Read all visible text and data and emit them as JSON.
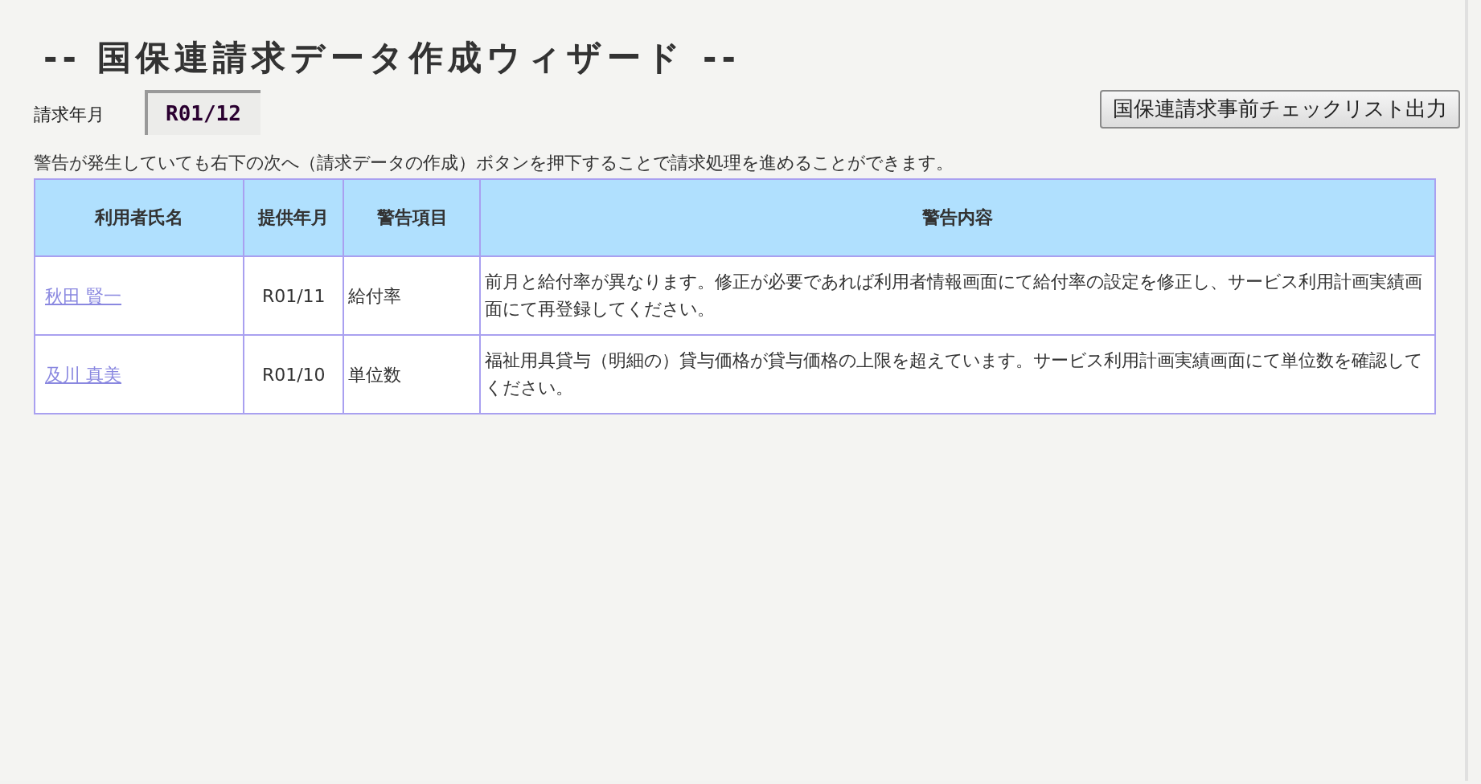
{
  "title": "-- 国保連請求データ作成ウィザード --",
  "billing_month": {
    "label": "請求年月",
    "value": "R01/12"
  },
  "checklist_button": "国保連請求事前チェックリスト出力",
  "notice": "警告が発生していても右下の次へ（請求データの作成）ボタンを押下することで請求処理を進めることができます。",
  "table": {
    "columns": [
      "利用者氏名",
      "提供年月",
      "警告項目",
      "警告内容"
    ],
    "rows": [
      {
        "name": "秋田 賢一",
        "month": "R01/11",
        "item": "給付率",
        "message": "前月と給付率が異なります。修正が必要であれば利用者情報画面にて給付率の設定を修正し、サービス利用計画実績画面にて再登録してください。"
      },
      {
        "name": "及川 真美",
        "month": "R01/10",
        "item": "単位数",
        "message": "福祉用具貸与（明細の）貸与価格が貸与価格の上限を超えています。サービス利用計画実績画面にて単位数を確認してください。"
      }
    ]
  }
}
